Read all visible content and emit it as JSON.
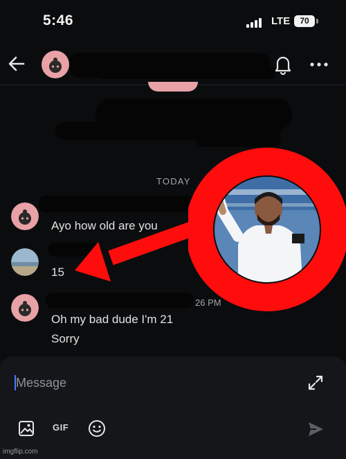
{
  "status_bar": {
    "time": "5:46",
    "network": "LTE",
    "battery": "70"
  },
  "header": {
    "back_icon": "back-arrow-icon",
    "bell_icon": "bell-icon",
    "more_icon": "more-dots-icon"
  },
  "conversation": {
    "day_divider": "TODAY",
    "messages": [
      {
        "text": "Ayo how old are you"
      },
      {
        "text": "15"
      },
      {
        "time": "26 PM",
        "lines": [
          "Oh my bad dude I'm 21",
          "Sorry"
        ]
      }
    ]
  },
  "composer": {
    "placeholder": "Message",
    "gif_label": "GIF"
  },
  "colors": {
    "background": "#0b0c0e",
    "avatar_pink": "#e8a2a6",
    "annotation_red": "#ff0d0d"
  },
  "watermark": "imgflip.com"
}
